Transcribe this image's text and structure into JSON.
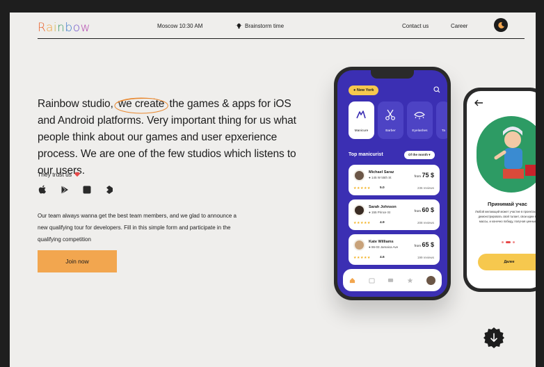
{
  "header": {
    "logo": "Rainbow",
    "location_time": "Moscow 10:30 AM",
    "brainstorm": "Brainstorm time",
    "nav_contact": "Contact us",
    "nav_career": "Career"
  },
  "hero": {
    "text_before": "Rainbow studio,",
    "highlight": "we create",
    "text_after": "the games & apps for iOS and Android platforms. Very important thing for us what people think about our games and user epxerience process. We are one of the few studios which listens to our users."
  },
  "trust": {
    "label": "They trust us"
  },
  "platform_icons": [
    "apple-icon",
    "google-play-icon",
    "microsoft-icon",
    "unity-icon"
  ],
  "description": "Our team always wanna get the best team members, and we glad to announce a new qualifying tour for developers. Fill in this simple form and participate in the qualifying competition",
  "cta": {
    "label": "Join now"
  },
  "phone_app": {
    "location": "New York",
    "categories": [
      {
        "label": "Manicure",
        "active": true
      },
      {
        "label": "Barber",
        "active": false
      },
      {
        "label": "Eyelashes",
        "active": false
      },
      {
        "label": "Ta",
        "active": false
      }
    ],
    "section_title": "Top manicurist",
    "filter": "Of the month",
    "cards": [
      {
        "name": "Michael Saraz",
        "address": "145 W 55th St",
        "price_prefix": "from",
        "price": "75 $",
        "stars": "★★★★★",
        "rating": "5.0",
        "reviews": "236 reviews"
      },
      {
        "name": "Sarah Johnson",
        "address": "155 Prince St",
        "price_prefix": "from",
        "price": "60 $",
        "stars": "★★★★★",
        "rating": "4.9",
        "reviews": "208 reviews"
      },
      {
        "name": "Kate Williams",
        "address": "86-03 Jamaica Ave",
        "price_prefix": "from",
        "price": "65 $",
        "stars": "★★★★★",
        "rating": "4.6",
        "reviews": "199 reviews"
      }
    ]
  },
  "phone_game": {
    "title": "Принимай учас",
    "text": "Любой желающий может участие в проектах, демонстрировать свой талант, свои идеи в массы, и конечно победу, получая ценные",
    "button": "Далее"
  },
  "colors": {
    "background": "#efeeec",
    "accent_orange": "#f2a64f",
    "app_purple": "#3b2fb3",
    "app_yellow": "#f6c84e",
    "dark": "#1c1c1c"
  }
}
